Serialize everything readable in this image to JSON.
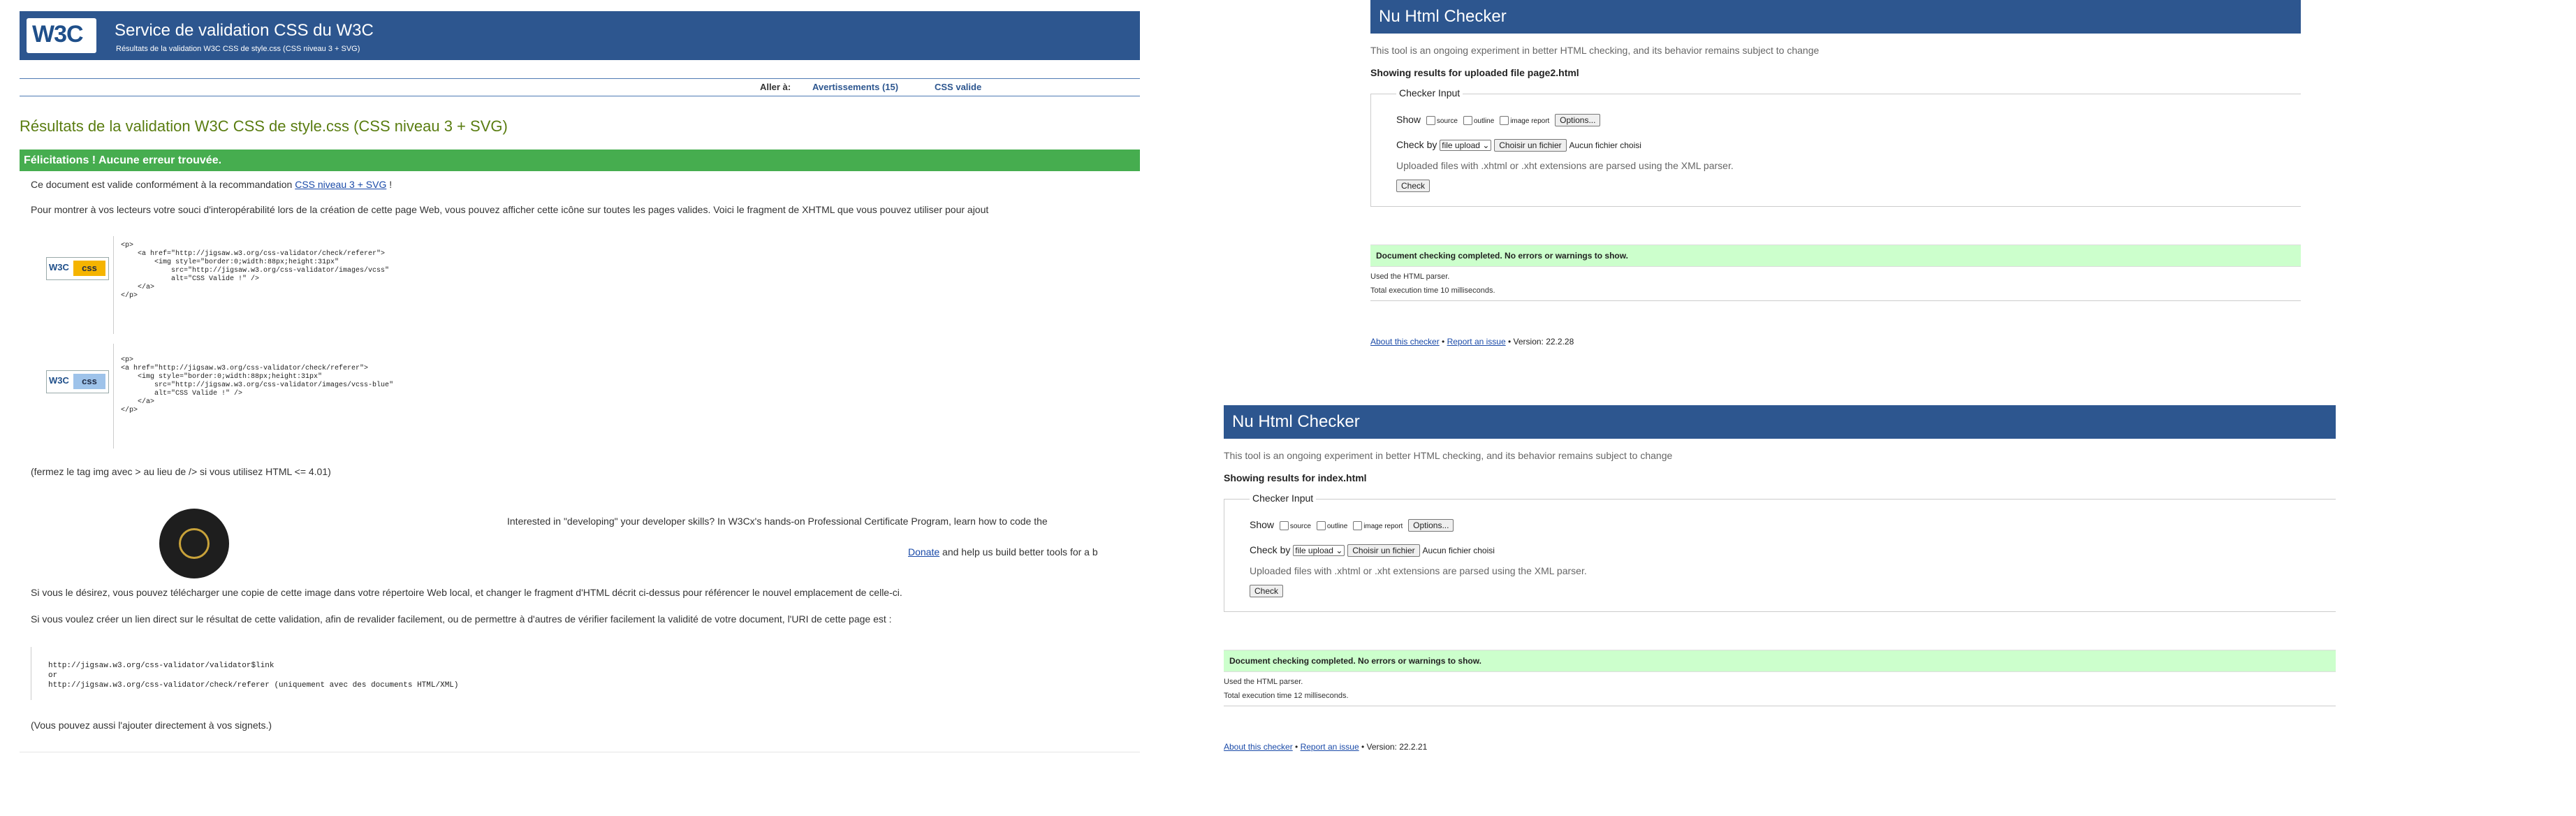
{
  "css_validator": {
    "logo_text": "W3C",
    "title": "Service de validation CSS du W3C",
    "subtitle": "Résultats de la validation W3C CSS de style.css (CSS niveau 3 + SVG)",
    "nav": {
      "goto_label": "Aller à:",
      "warnings_link": "Avertissements (15)",
      "valid_link": "CSS valide"
    },
    "heading": "Résultats de la validation W3C CSS de style.css (CSS niveau 3 + SVG)",
    "congrats": "Félicitations ! Aucune erreur trouvée.",
    "valid_text_prefix": "Ce document est valide conformément à la recommandation",
    "valid_link": "CSS niveau 3 + SVG",
    "valid_suffix": "!",
    "icon_text": "Pour montrer à vos lecteurs votre souci d'interopérabilité lors de la création de cette page Web, vous pouvez afficher cette icône sur toutes les pages valides. Voici le fragment de XHTML que vous pouvez utiliser pour ajout",
    "badge1": {
      "w3": "W3C",
      "css": "css"
    },
    "snippet1": "<p>\n    <a href=\"http://jigsaw.w3.org/css-validator/check/referer\">\n        <img style=\"border:0;width:88px;height:31px\"\n            src=\"http://jigsaw.w3.org/css-validator/images/vcss\"\n            alt=\"CSS Valide !\" />\n    </a>\n</p>",
    "badge2": {
      "w3": "W3C",
      "css": "css"
    },
    "snippet2": "<p>\n<a href=\"http://jigsaw.w3.org/css-validator/check/referer\">\n    <img style=\"border:0;width:88px;height:31px\"\n        src=\"http://jigsaw.w3.org/css-validator/images/vcss-blue\"\n        alt=\"CSS Valide !\" />\n    </a>\n</p>",
    "close_tag_note": "(fermez le tag img avec > au lieu de /> si vous utilisez HTML <= 4.01)",
    "promo_text": "Interested in \"developing\" your developer skills? In W3Cx's hands-on Professional Certificate Program, learn how to code the",
    "donate_link": "Donate",
    "donate_text": "and help us build better tools for a b",
    "download_text": "Si vous le désirez, vous pouvez télécharger une copie de cette image dans votre répertoire Web local, et changer le fragment d'HTML décrit ci-dessus pour référencer le nouvel emplacement de celle-ci.",
    "link_text": "Si vous voulez créer un lien direct sur le résultat de cette validation, afin de revalider facilement, ou de permettre à d'autres de vérifier facilement la validité de votre document, l'URI de cette page est :",
    "uri_block": "http://jigsaw.w3.org/css-validator/validator$link\nor\nhttp://jigsaw.w3.org/css-validator/check/referer (uniquement avec des documents HTML/XML)",
    "bookmark_text": "(Vous pouvez aussi l'ajouter directement à vos signets.)"
  },
  "nu_checkers": [
    {
      "title": "Nu Html Checker",
      "intro": "This tool is an ongoing experiment in better HTML checking, and its behavior remains subject to change",
      "showing": "Showing results for uploaded file page2.html",
      "legend": "Checker Input",
      "show_label": "Show",
      "cb_source": "source",
      "cb_outline": "outline",
      "cb_image_report": "image report",
      "options_button": "Options...",
      "check_by_label": "Check by",
      "check_by_value": "file upload",
      "choose_file_button": "Choisir un fichier",
      "no_file": "Aucun fichier choisi",
      "upload_note": "Uploaded files with .xhtml or .xht extensions are parsed using the XML parser.",
      "check_button": "Check",
      "success": "Document checking completed. No errors or warnings to show.",
      "parser": "Used the HTML parser.",
      "exec_time": "Total execution time 10 milliseconds.",
      "about_link": "About this checker",
      "report_link": "Report an issue",
      "version": "Version: 22.2.28"
    },
    {
      "title": "Nu Html Checker",
      "intro": "This tool is an ongoing experiment in better HTML checking, and its behavior remains subject to change",
      "showing": "Showing results for index.html",
      "legend": "Checker Input",
      "show_label": "Show",
      "cb_source": "source",
      "cb_outline": "outline",
      "cb_image_report": "image report",
      "options_button": "Options...",
      "check_by_label": "Check by",
      "check_by_value": "file upload",
      "choose_file_button": "Choisir un fichier",
      "no_file": "Aucun fichier choisi",
      "upload_note": "Uploaded files with .xhtml or .xht extensions are parsed using the XML parser.",
      "check_button": "Check",
      "success": "Document checking completed. No errors or warnings to show.",
      "parser": "Used the HTML parser.",
      "exec_time": "Total execution time 12 milliseconds.",
      "about_link": "About this checker",
      "report_link": "Report an issue",
      "version": "Version: 22.2.21"
    }
  ],
  "colors": {
    "header_blue": "#2d568f",
    "success_green": "#46ad4f",
    "heading_green": "#5a7d11",
    "nu_success_bg": "#ccffcc"
  }
}
